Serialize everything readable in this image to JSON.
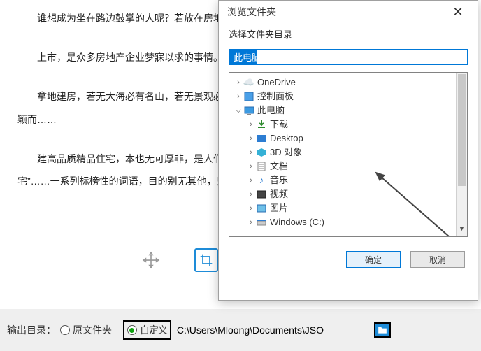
{
  "doc": {
    "p1": "谁想成为坐在路边鼓掌的人呢？若放在房地产行……为，大家都想做那个被鼓掌、被关注的英雄。",
    "p2": "上市，是众多房地产企业梦寐以求的事情。因为……增加，同时也意味着头上的光环在增加。",
    "p3": "拿地建房，若无大海必有名山，若无景观必有……王，做标杆，只为了能够在众多的竞争对手中脱颖而……",
    "p4": "建高品质精品住宅，本也无可厚非，是人们生活……而，每当豪宅出现的时候，随之出现的还有“豪宅”……一系列标榜性的词语，目的别无其他，只是为了凸显……"
  },
  "dialog": {
    "title": "浏览文件夹",
    "subtitle": "选择文件夹目录",
    "input_value": "此电脑",
    "items": {
      "onedrive": "OneDrive",
      "control": "控制面板",
      "thispc": "此电脑",
      "downloads": "下载",
      "desktop": "Desktop",
      "objects3d": "3D 对象",
      "documents": "文档",
      "music": "音乐",
      "videos": "视频",
      "pictures": "图片",
      "cdrive": "Windows (C:)"
    },
    "ok": "确定",
    "cancel": "取消"
  },
  "bottom": {
    "label": "输出目录：",
    "radio_original": "原文件夹",
    "radio_custom": "自定义",
    "path": "C:\\Users\\Mloong\\Documents\\JSO"
  }
}
